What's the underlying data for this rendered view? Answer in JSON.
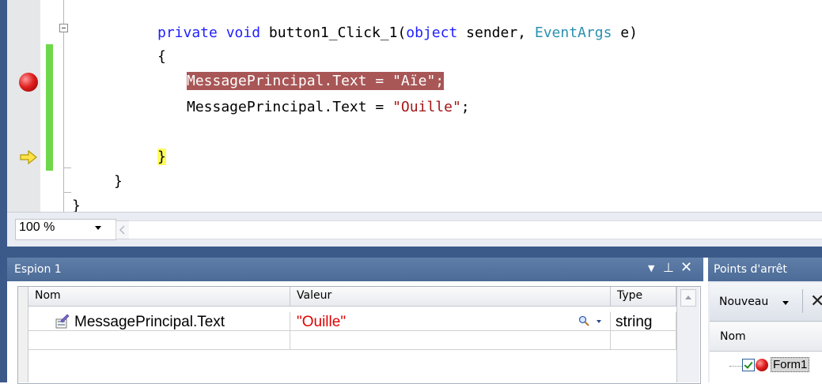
{
  "editor": {
    "method_signature": {
      "kw_private": "private",
      "kw_void": "void",
      "name": "button1_Click_1(",
      "kw_object": "object",
      "sender": " sender, ",
      "type_eventargs": "EventArgs",
      "tail": " e)"
    },
    "open_brace": "{",
    "line_breakpoint": {
      "prefix": "MessagePrincipal.Text = ",
      "string": "\"Aïe\"",
      "suffix": ";"
    },
    "line_two": {
      "prefix": "MessagePrincipal.Text = ",
      "string": "\"Ouille\"",
      "suffix": ";"
    },
    "close_brace_method": "}",
    "close_brace_class": "}",
    "close_brace_ns": "}"
  },
  "zoom": {
    "value": "100 %"
  },
  "watch": {
    "title": "Espion 1",
    "columns": {
      "name": "Nom",
      "value": "Valeur",
      "type": "Type"
    },
    "rows": [
      {
        "name": "MessagePrincipal.Text",
        "value": "\"Ouille\"",
        "type": "string"
      }
    ]
  },
  "breakpoints": {
    "title": "Points d'arrêt",
    "new_label": "Nouveau",
    "column_name": "Nom",
    "row_label": "Form1"
  },
  "colors": {
    "keyword": "#1f1fff",
    "type": "#2b91af",
    "string": "#a31515",
    "breakpoint_highlight": "#a85656",
    "current_line": "#ffff5c",
    "tool_title": "#4c6b97"
  }
}
